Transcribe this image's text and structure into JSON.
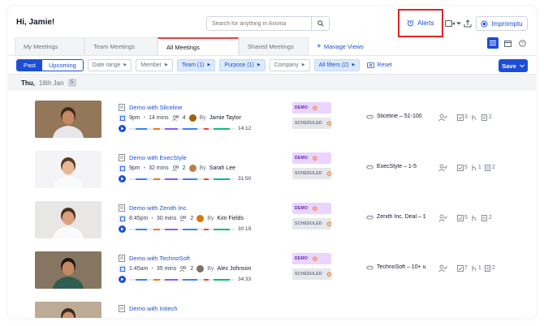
{
  "header": {
    "greeting": "Hi, Jamie!",
    "search_placeholder": "Search for anything in Avoma",
    "alerts_label": "Alerts",
    "impromptu_label": "Impromptu"
  },
  "tabs": [
    {
      "label": "My Meetings",
      "active": false
    },
    {
      "label": "Team Meetings",
      "active": false
    },
    {
      "label": "All Meetings",
      "active": true
    },
    {
      "label": "Shared Meetings",
      "active": false
    }
  ],
  "manage_views_label": "Manage Views",
  "filters": {
    "past_label": "Past",
    "upcoming_label": "Upcoming",
    "date_range": "Date range",
    "member": "Member",
    "team": "Team (1)",
    "purpose": "Purpose (1)",
    "company": "Company",
    "all_filters": "All filters (2)",
    "reset": "Reset",
    "save": "Save"
  },
  "date_group": {
    "day": "Thu,",
    "date": "16th Jan",
    "count": "5"
  },
  "meetings": [
    {
      "title": "Demo with Sliceline",
      "time": "9pm",
      "length": "14 mins",
      "attendees": "4",
      "host": "Jamie Taylor",
      "by": "By",
      "duration": "14:12",
      "tag1": "DEMO",
      "tag2": "SCHEDULED",
      "deal": "Sliceline – 51-100",
      "stat_a": "3",
      "stat_b": "",
      "stat_c": "2",
      "avatar_color": "#a16207",
      "thumb": {
        "bg": "#8b6b4a",
        "shirt": "#e5e7eb",
        "skin": "#c68863",
        "hair": "#3b2a1e"
      }
    },
    {
      "title": "Demo with ExecStyle",
      "time": "9pm",
      "length": "32 mins",
      "attendees": "2",
      "host": "Sarah Lee",
      "by": "By",
      "duration": "31:50",
      "tag1": "DEMO",
      "tag2": "SCHEDULED",
      "deal": "ExecStyle – 1-5",
      "stat_a": "5",
      "stat_b": "1",
      "stat_c": "2",
      "avatar_color": "#be7c4d",
      "thumb": {
        "bg": "#f3f4f6",
        "shirt": "#f9fafb",
        "skin": "#e8b896",
        "hair": "#5b3a22"
      }
    },
    {
      "title": "Demo with Zenith Inc.",
      "time": "8:45pm",
      "length": "30 mins",
      "attendees": "2",
      "host": "Kim Fields",
      "by": "By",
      "duration": "30:19",
      "tag1": "DEMO",
      "tag2": "SCHEDULED",
      "deal": "Zenith Inc. Deal – 1",
      "stat_a": "5",
      "stat_b": "",
      "stat_c": "2",
      "avatar_color": "#d97706",
      "thumb": {
        "bg": "#e7e5e4",
        "shirt": "#fafafa",
        "skin": "#d9a07a",
        "hair": "#4a2f1d"
      }
    },
    {
      "title": "Demo with TechnoSoft",
      "time": "1:45am",
      "length": "35 mins",
      "attendees": "2",
      "host": "Alex Johnson",
      "by": "By",
      "duration": "34:33",
      "tag1": "DEMO",
      "tag2": "SCHEDULED",
      "deal": "TechnoSoft – 10+ u",
      "stat_a": "7",
      "stat_b": "1",
      "stat_c": "2",
      "avatar_color": "#78716c",
      "thumb": {
        "bg": "#7c6a53",
        "shirt": "#2f5d50",
        "skin": "#c48a64",
        "hair": "#1f1611"
      }
    },
    {
      "title": "Demo with Initech",
      "time": "",
      "length": "",
      "attendees": "",
      "host": "",
      "by": "",
      "duration": "",
      "tag1": "",
      "tag2": "",
      "deal": "",
      "stat_a": "",
      "stat_b": "",
      "stat_c": "",
      "avatar_color": "#a8a29e",
      "thumb": {
        "bg": "#b8a48c",
        "shirt": "#d6d3d1",
        "skin": "#c69572",
        "hair": "#3f2a1d"
      }
    }
  ],
  "colors": {
    "accent": "#1d4ed8",
    "highlight": "#e02424",
    "demo_tag": "#e9d5ff",
    "hubspot": "#f97316"
  }
}
